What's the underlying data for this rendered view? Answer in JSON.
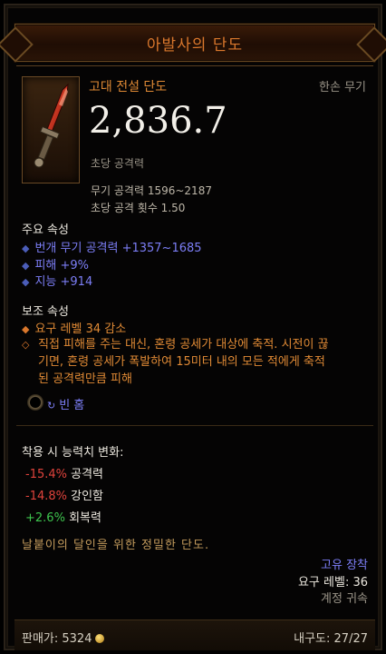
{
  "item": {
    "name": "아발사의 단도",
    "quality": "고대 전설 단도",
    "slot": "한손 무기",
    "dps": "2,836.7",
    "dps_label": "초당 공격력",
    "damage_range": "무기 공격력 1596~2187",
    "attack_speed": "초당 공격 횟수 1.50"
  },
  "primary": {
    "header": "주요 속성",
    "items": [
      "번개 무기 공격력 +1357~1685",
      "피해 +9%",
      "지능 +914"
    ]
  },
  "secondary": {
    "header": "보조 속성",
    "req_reduction": "요구 레벨 34 감소",
    "legendary_power_lines": [
      "직접 피해를 주는 대신, 혼령 공세가 대상에 축적. 시전이 끊",
      "기면, 혼령 공세가 폭발하여 15미터 내의 모든 적에게 축적",
      "된 공격력만큼 피해"
    ]
  },
  "socket": {
    "label": "빈 홈"
  },
  "stat_change": {
    "header": "착용 시 능력치 변화:",
    "rows": [
      {
        "value": "-15.4%",
        "label": "공격력"
      },
      {
        "value": "-14.8%",
        "label": "강인함"
      },
      {
        "value": "+2.6%",
        "label": "회복력"
      }
    ]
  },
  "flavor": "날붙이의 달인을 위한 정밀한 단도.",
  "meta": {
    "unique_equip": "고유 장착",
    "required_level": "요구 레벨: 36",
    "account_bound": "계정 귀속"
  },
  "footer": {
    "sell_label": "판매가: 5324",
    "durability": "내구도: 27/27"
  },
  "colors": {
    "legendary_orange": "#e08a35",
    "magic_blue": "#7c7ef6",
    "negative_red": "#e0433c",
    "positive_green": "#3ec44e"
  },
  "icons": [
    "dagger-icon",
    "socket-icon",
    "gold-coin-icon"
  ]
}
